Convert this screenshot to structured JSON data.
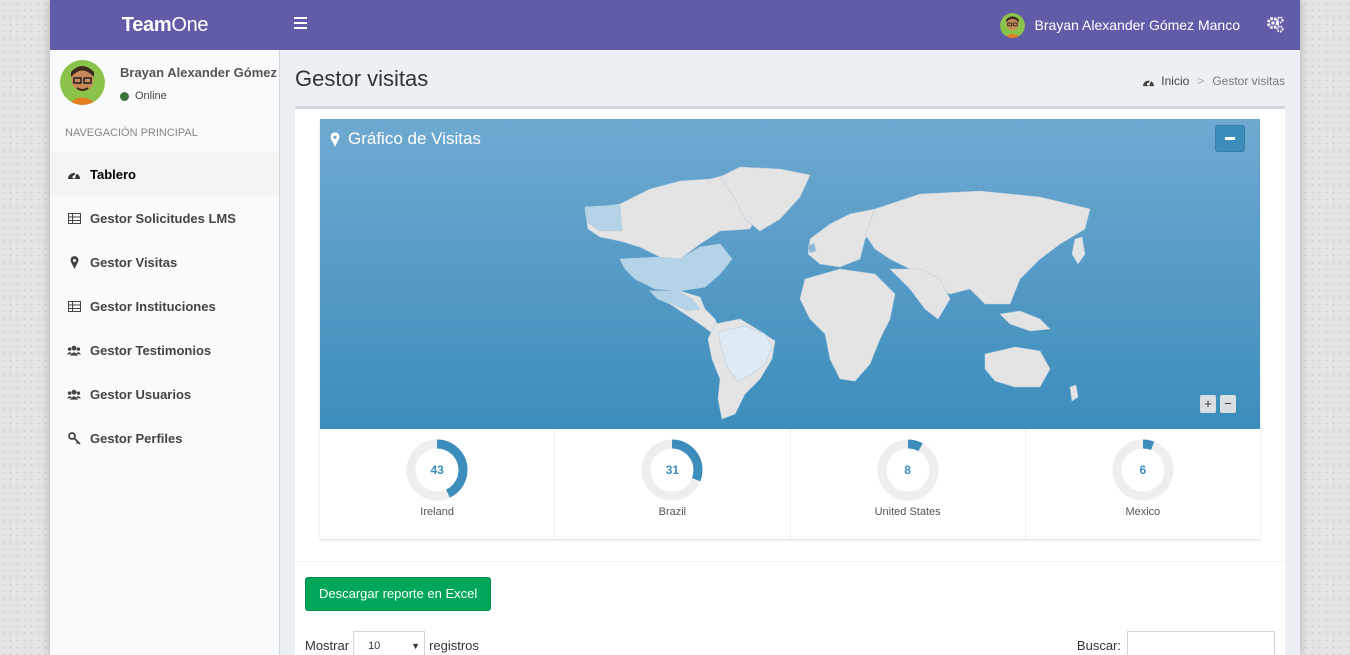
{
  "brand": {
    "bold": "Team",
    "light": "One"
  },
  "topbar": {
    "user_name": "Brayan Alexander Gómez Manco"
  },
  "sidebar": {
    "user_name": "Brayan Alexander Gómez M",
    "status": "Online",
    "nav_header": "NAVEGACIÓN PRINCIPAL",
    "items": [
      {
        "label": "Tablero",
        "icon": "dashboard-icon"
      },
      {
        "label": "Gestor Solicitudes LMS",
        "icon": "table-icon"
      },
      {
        "label": "Gestor Visitas",
        "icon": "map-marker-icon"
      },
      {
        "label": "Gestor Instituciones",
        "icon": "table-icon"
      },
      {
        "label": "Gestor Testimonios",
        "icon": "users-icon"
      },
      {
        "label": "Gestor Usuarios",
        "icon": "users-icon"
      },
      {
        "label": "Gestor Perfiles",
        "icon": "key-icon"
      }
    ]
  },
  "page": {
    "title": "Gestor visitas",
    "breadcrumb": {
      "home": "Inicio",
      "current": "Gestor visitas"
    }
  },
  "map": {
    "title": "Gráfico de Visitas",
    "zoom_in": "+",
    "zoom_out": "−"
  },
  "stats": [
    {
      "value": "43",
      "label": "Ireland",
      "fraction": 0.43
    },
    {
      "value": "31",
      "label": "Brazil",
      "fraction": 0.31
    },
    {
      "value": "8",
      "label": "United States",
      "fraction": 0.08
    },
    {
      "value": "6",
      "label": "Mexico",
      "fraction": 0.06
    }
  ],
  "actions": {
    "excel_label": "Descargar reporte en Excel"
  },
  "table_controls": {
    "show_label": "Mostrar",
    "page_size": "10",
    "records_label": "registros",
    "search_label": "Buscar:"
  },
  "colors": {
    "topbar": "#605ca8",
    "accent": "#3c8dbc",
    "success": "#00a65a"
  }
}
